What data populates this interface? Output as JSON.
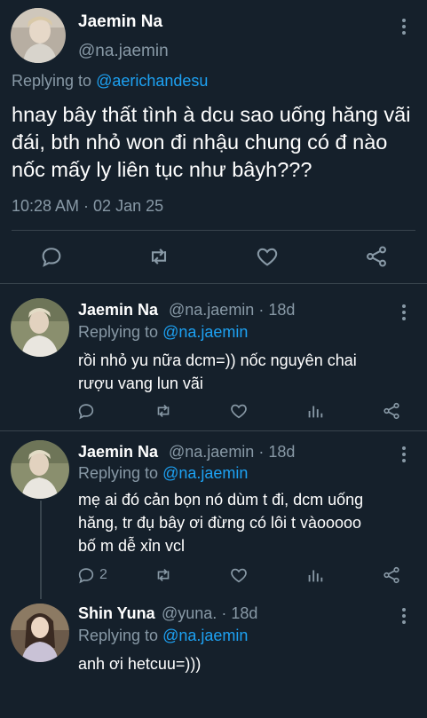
{
  "main_tweet": {
    "author_name": "Jaemin Na",
    "author_handle": "@na.jaemin",
    "replying_prefix": "Replying to",
    "replying_to": "@aerichandesu",
    "text": "hnay bây thất tình à dcu sao uống hăng vãi đái, bth nhỏ won đi nhậu chung có đ nào nốc mấy ly liên tục như bâyh???",
    "timestamp": "10:28 AM · 02 Jan 25",
    "actions": [
      "reply-icon",
      "retweet-icon",
      "like-icon",
      "share-icon"
    ]
  },
  "replies": [
    {
      "author_name": "Jaemin Na",
      "author_handle": "@na.jaemin",
      "age": "· 18d",
      "replying_prefix": "Replying to",
      "replying_to": "@na.jaemin",
      "text_line1": "rồi nhỏ yu nữa dcm=)) nốc nguyên chai",
      "text_line2": "rượu vang lun vãi",
      "reply_count": ""
    },
    {
      "author_name": "Jaemin Na",
      "author_handle": "@na.jaemin",
      "age": "· 18d",
      "replying_prefix": "Replying to",
      "replying_to": "@na.jaemin",
      "text_line1": "mẹ ai đó cản bọn nó dùm t đi, dcm uống",
      "text_line2": "hăng, tr đụ bây ơi đừng có lôi t vàooooo",
      "text_line3": "bố m dễ xỉn vcl",
      "reply_count": "2"
    },
    {
      "author_name": "Shin Yuna",
      "author_handle": "@yuna.",
      "age": "· 18d",
      "replying_prefix": "Replying to",
      "replying_to": "@na.jaemin",
      "text_line1": "anh ơi hetcuu=)))"
    }
  ],
  "colors": {
    "background": "#15202b",
    "divider": "#38444d",
    "secondary_text": "#8899a6",
    "link": "#1da1f2"
  }
}
